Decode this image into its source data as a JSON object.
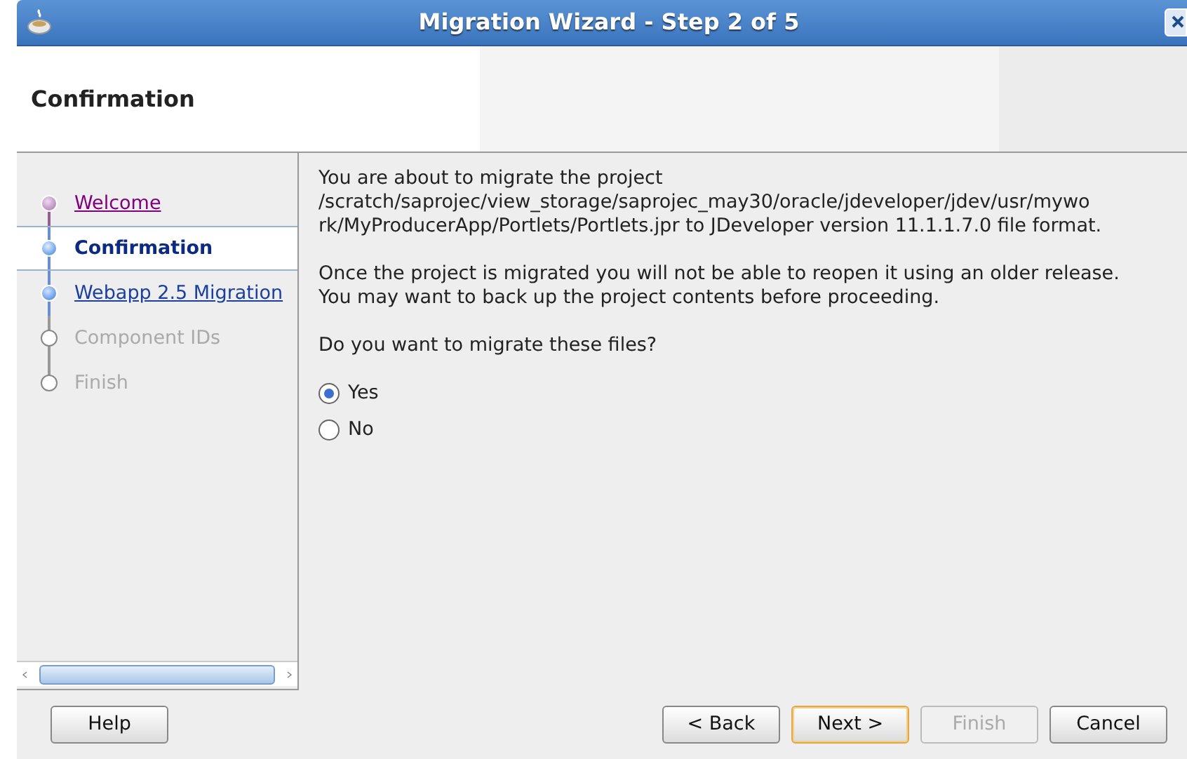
{
  "window": {
    "title": "Migration Wizard - Step 2 of 5"
  },
  "header": {
    "title": "Confirmation"
  },
  "steps": [
    {
      "label": "Welcome",
      "visited": true,
      "disabled": false,
      "selected": false
    },
    {
      "label": "Confirmation",
      "visited": false,
      "disabled": false,
      "selected": true
    },
    {
      "label": "Webapp 2.5 Migration",
      "visited": false,
      "disabled": false,
      "selected": false
    },
    {
      "label": "Component IDs",
      "visited": false,
      "disabled": true,
      "selected": false
    },
    {
      "label": "Finish",
      "visited": false,
      "disabled": true,
      "selected": false
    }
  ],
  "content": {
    "paragraphs": [
      {
        "lines": [
          "You are about to migrate the project",
          "/scratch/saprojec/view_storage/saprojec_may30/oracle/jdeveloper/jdev/usr/mywo",
          "rk/MyProducerApp/Portlets/Portlets.jpr to JDeveloper version 11.1.1.7.0 file format."
        ]
      },
      {
        "lines": [
          "Once the project is migrated you will not be able to reopen it using an older release.",
          "You may want to back up the project contents before proceeding."
        ]
      },
      {
        "lines": [
          "Do you want to migrate these files?"
        ]
      }
    ],
    "options": [
      {
        "label": "Yes",
        "selected": true
      },
      {
        "label": "No",
        "selected": false
      }
    ]
  },
  "buttons": {
    "left": [
      {
        "label": "Help",
        "disabled": false,
        "default": false
      }
    ],
    "right": [
      {
        "label": "< Back",
        "disabled": false,
        "default": false
      },
      {
        "label": "Next >",
        "disabled": false,
        "default": true
      },
      {
        "label": "Finish",
        "disabled": true,
        "default": false
      },
      {
        "label": "Cancel",
        "disabled": false,
        "default": false
      }
    ]
  }
}
